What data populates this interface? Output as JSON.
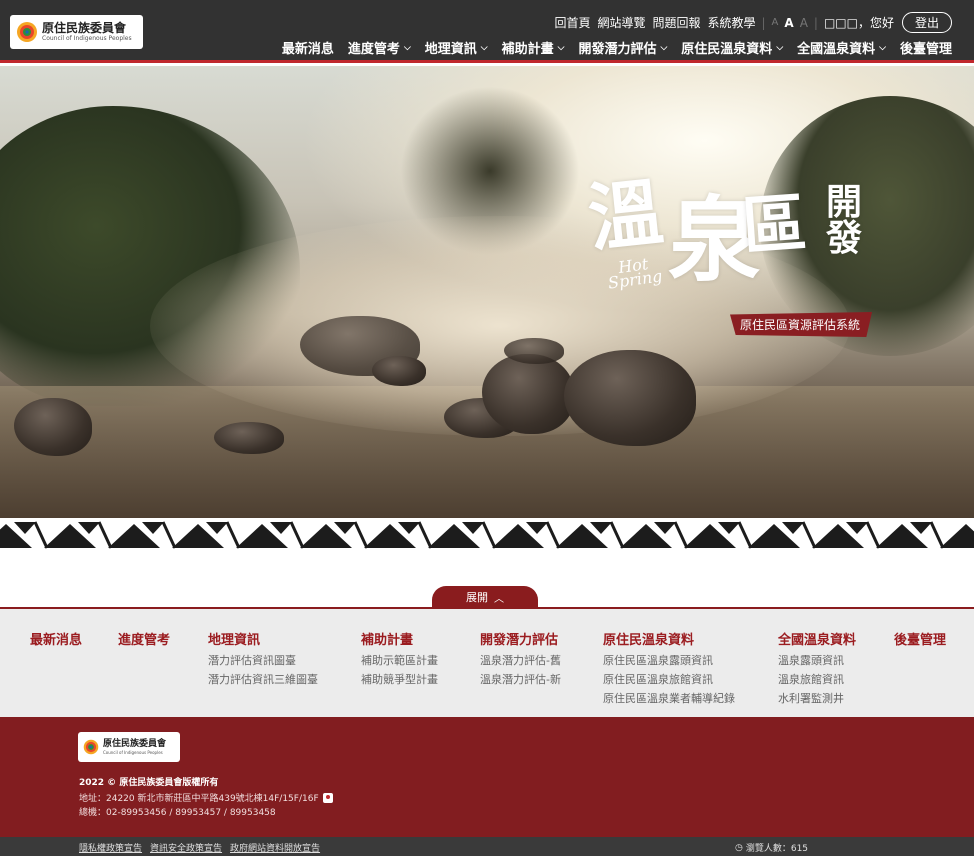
{
  "logo": {
    "name_zh": "原住民族委員會",
    "name_en": "Council of Indigenous Peoples"
  },
  "utility": {
    "home": "回首頁",
    "sitemap": "網站導覽",
    "report": "問題回報",
    "tutorial": "系統教學",
    "font_small": "A",
    "font_medium": "A",
    "font_large": "A",
    "user_name": "□□□",
    "greeting": "，您好",
    "login": "登出"
  },
  "nav": [
    {
      "label": "最新消息",
      "has_dropdown": false
    },
    {
      "label": "進度管考",
      "has_dropdown": true
    },
    {
      "label": "地理資訊",
      "has_dropdown": true
    },
    {
      "label": "補助計畫",
      "has_dropdown": true
    },
    {
      "label": "開發潛力評估",
      "has_dropdown": true
    },
    {
      "label": "原住民溫泉資料",
      "has_dropdown": true
    },
    {
      "label": "全國溫泉資料",
      "has_dropdown": true
    },
    {
      "label": "後臺管理",
      "has_dropdown": false
    }
  ],
  "hero": {
    "c1": "溫",
    "c2": "泉",
    "c3": "區",
    "c4": "開發",
    "hot": "Hot",
    "spring": "Spring",
    "badge": "原住民區資源評估系統"
  },
  "expand": {
    "label": "展開",
    "icon": "chevron-up-icon"
  },
  "sitemap": [
    {
      "title": "最新消息",
      "items": []
    },
    {
      "title": "進度管考",
      "items": []
    },
    {
      "title": "地理資訊",
      "items": [
        "潛力評估資訊圖臺",
        "潛力評估資訊三維圖臺"
      ]
    },
    {
      "title": "補助計畫",
      "items": [
        "補助示範區計畫",
        "補助競爭型計畫"
      ]
    },
    {
      "title": "開發潛力評估",
      "items": [
        "溫泉潛力評估-舊",
        "溫泉潛力評估-新"
      ]
    },
    {
      "title": "原住民溫泉資料",
      "items": [
        "原住民區溫泉露頭資訊",
        "原住民區溫泉旅館資訊",
        "原住民區溫泉業者輔導紀錄"
      ]
    },
    {
      "title": "全國溫泉資料",
      "items": [
        "溫泉露頭資訊",
        "溫泉旅館資訊",
        "水利署監測井"
      ]
    },
    {
      "title": "後臺管理",
      "items": []
    }
  ],
  "footer": {
    "copyright": "2022 © 原住民族委員會版權所有",
    "address": "地址：24220 新北市新莊區中平路439號北棟14F/15F/16F",
    "phone": "總機：02-89953456 / 89953457 / 89953458",
    "links": [
      "隱私權政策宣告",
      "資訊安全政策宣告",
      "政府網站資料開放宣告"
    ],
    "visits_label": "瀏覽人數：615"
  },
  "colors": {
    "accent": "#8a1c1e",
    "header_bg": "#323232",
    "footer_bg": "#821d20",
    "sitemap_bg": "#ececec"
  }
}
